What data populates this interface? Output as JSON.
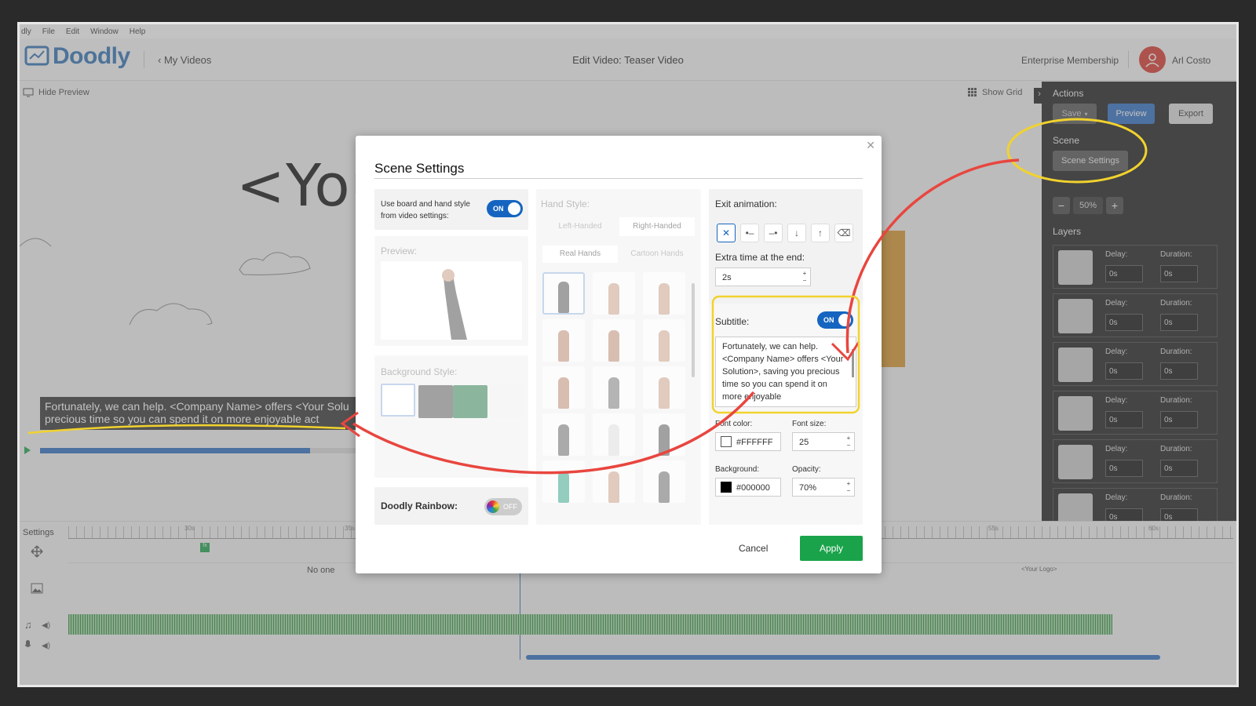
{
  "menu": [
    "dly",
    "File",
    "Edit",
    "Window",
    "Help"
  ],
  "header": {
    "app_name": "Doodly",
    "back_label": "My Videos",
    "title": "Edit Video: Teaser Video",
    "membership": "Enterprise Membership",
    "user_name": "Arl Costo"
  },
  "canvas": {
    "hide_preview": "Hide Preview",
    "show_grid": "Show Grid",
    "big_text": "<You",
    "subtitle_line1": "Fortunately, we can help. <Company Name> offers <Your Solu",
    "subtitle_line2": "precious time so you can spend it on more enjoyable act",
    "progress": 0.82
  },
  "actions": {
    "heading": "Actions",
    "save": "Save",
    "preview": "Preview",
    "export": "Export",
    "scene_heading": "Scene",
    "scene_settings": "Scene Settings",
    "zoom": "50%",
    "layers_heading": "Layers",
    "layers": [
      {
        "delay_label": "Delay:",
        "delay": "0s",
        "duration_label": "Duration:",
        "duration": "0s"
      },
      {
        "delay_label": "Delay:",
        "delay": "0s",
        "duration_label": "Duration:",
        "duration": "0s"
      },
      {
        "delay_label": "Delay:",
        "delay": "0s",
        "duration_label": "Duration:",
        "duration": "0s"
      },
      {
        "delay_label": "Delay:",
        "delay": "0s",
        "duration_label": "Duration:",
        "duration": "0s"
      },
      {
        "delay_label": "Delay:",
        "delay": "0s",
        "duration_label": "Duration:",
        "duration": "0s"
      },
      {
        "delay_label": "Delay:",
        "delay": "0s",
        "duration_label": "Duration:",
        "duration": "0s"
      }
    ]
  },
  "timeline": {
    "settings_label": "Settings",
    "ticks": [
      "30s",
      "35s",
      "55s",
      "60s"
    ],
    "scene_caption": "No one",
    "logo_caption": "<Your Logo>"
  },
  "modal": {
    "title": "Scene Settings",
    "use_board_label": "Use board and hand style from video settings:",
    "use_board_toggle": "ON",
    "preview_label": "Preview:",
    "background_style_label": "Background Style:",
    "rainbow_label": "Doodly Rainbow:",
    "rainbow_toggle": "OFF",
    "hand_style_label": "Hand Style:",
    "left_handed": "Left-Handed",
    "right_handed": "Right-Handed",
    "real_hands": "Real Hands",
    "cartoon_hands": "Cartoon Hands",
    "exit_animation_label": "Exit animation:",
    "extra_time_label": "Extra time at the end:",
    "extra_time": "2s",
    "subtitle_label": "Subtitle:",
    "subtitle_toggle": "ON",
    "subtitle_text": "Fortunately, we can help. <Company Name> offers <Your Solution>, saving you precious time so you can spend it on more enjoyable",
    "font_color_label": "Font color:",
    "font_color": "#FFFFFF",
    "font_size_label": "Font size:",
    "font_size": "25",
    "background_label": "Background:",
    "background_color": "#000000",
    "opacity_label": "Opacity:",
    "opacity": "70%",
    "cancel": "Cancel",
    "apply": "Apply"
  },
  "colors": {
    "brand": "#2c6fb4",
    "primary_button": "#1565c0",
    "apply": "#1aa34a",
    "annotation_red": "#e8463f",
    "annotation_yellow": "#f2d22e"
  }
}
